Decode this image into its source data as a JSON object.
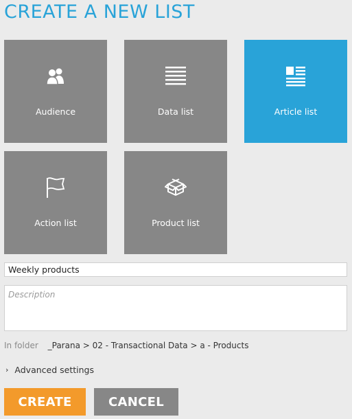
{
  "page": {
    "title": "CREATE A NEW LIST"
  },
  "tiles": [
    {
      "label": "Audience",
      "icon": "audience-icon"
    },
    {
      "label": "Data list",
      "icon": "data-list-icon"
    },
    {
      "label": "Article list",
      "icon": "article-list-icon",
      "selected": true
    },
    {
      "label": "Action list",
      "icon": "flag-icon"
    },
    {
      "label": "Product list",
      "icon": "product-box-icon"
    }
  ],
  "form": {
    "name_value": "Weekly products",
    "description_placeholder": "Description",
    "folder_label": "In folder",
    "folder_path": "_Parana > 02 - Transactional Data > a - Products",
    "advanced_label": "Advanced settings"
  },
  "buttons": {
    "create": "CREATE",
    "cancel": "CANCEL"
  },
  "colors": {
    "accent": "#29a3d8",
    "tile": "#878787",
    "create": "#f39a2b"
  }
}
